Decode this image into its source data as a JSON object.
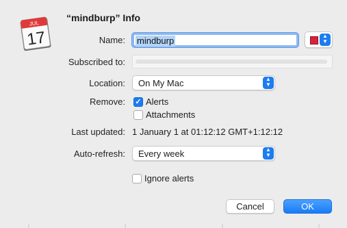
{
  "dialog": {
    "title": "“mindburp” Info"
  },
  "calendar_icon": {
    "month": "JUL",
    "day": "17"
  },
  "form": {
    "name_label": "Name:",
    "name_value": "mindburp",
    "color": "#d8243a",
    "subscribed_label": "Subscribed to:",
    "subscribed_value": "",
    "location_label": "Location:",
    "location_value": "On My Mac",
    "remove_label": "Remove:",
    "remove_alerts_label": "Alerts",
    "remove_alerts_checked": true,
    "remove_attachments_label": "Attachments",
    "remove_attachments_checked": false,
    "last_updated_label": "Last updated:",
    "last_updated_value": "1 January 1 at 01:12:12 GMT+1:12:12",
    "autorefresh_label": "Auto-refresh:",
    "autorefresh_value": "Every week",
    "ignore_alerts_label": "Ignore alerts",
    "ignore_alerts_checked": false
  },
  "buttons": {
    "cancel": "Cancel",
    "ok": "OK"
  },
  "colors": {
    "accent": "#1c7cf2",
    "background": "#ececec"
  }
}
